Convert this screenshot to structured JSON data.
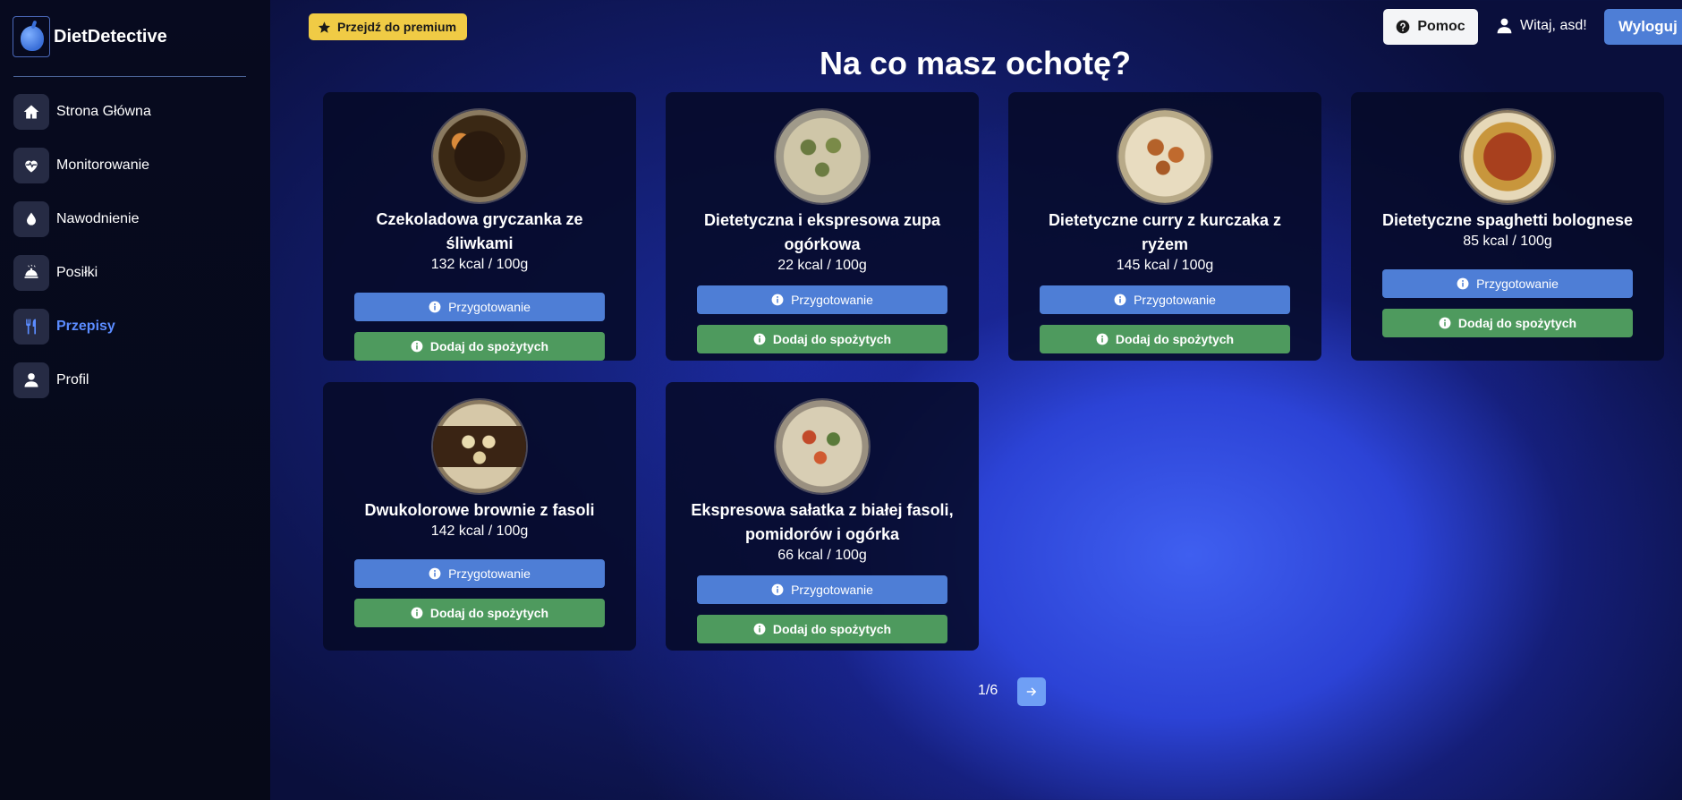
{
  "brand": {
    "name": "DietDetective"
  },
  "sidebar": {
    "items": [
      {
        "label": "Strona Główna",
        "icon": "home-icon"
      },
      {
        "label": "Monitorowanie",
        "icon": "heart-pulse-icon"
      },
      {
        "label": "Nawodnienie",
        "icon": "droplet-icon"
      },
      {
        "label": "Posiłki",
        "icon": "cloche-icon"
      },
      {
        "label": "Przepisy",
        "icon": "utensils-icon",
        "active": true
      },
      {
        "label": "Profil",
        "icon": "user-icon"
      }
    ]
  },
  "header": {
    "premium_label": "Przejdź do premium",
    "help_label": "Pomoc",
    "welcome_text": "Witaj, asd!",
    "logout_label": "Wyloguj"
  },
  "main": {
    "title": "Na co masz ochotę?",
    "recipes": [
      {
        "title": "Czekoladowa gryczanka ze śliwkami",
        "kcal": "132 kcal / 100g",
        "prep_label": "Przygotowanie",
        "add_label": "Dodaj do spożytych"
      },
      {
        "title": "Dietetyczna i ekspresowa zupa ogórkowa",
        "kcal": "22 kcal / 100g",
        "prep_label": "Przygotowanie",
        "add_label": "Dodaj do spożytych"
      },
      {
        "title": "Dietetyczne curry z kurczaka z ryżem",
        "kcal": "145 kcal / 100g",
        "prep_label": "Przygotowanie",
        "add_label": "Dodaj do spożytych"
      },
      {
        "title": "Dietetyczne spaghetti bolognese",
        "kcal": "85 kcal / 100g",
        "prep_label": "Przygotowanie",
        "add_label": "Dodaj do spożytych"
      },
      {
        "title": "Dwukolorowe brownie z fasoli",
        "kcal": "142 kcal / 100g",
        "prep_label": "Przygotowanie",
        "add_label": "Dodaj do spożytych"
      },
      {
        "title": "Ekspresowa sałatka z białej fasoli, pomidorów i ogórka",
        "kcal": "66 kcal / 100g",
        "prep_label": "Przygotowanie",
        "add_label": "Dodaj do spożytych"
      }
    ]
  },
  "pagination": {
    "text": "1/6"
  },
  "colors": {
    "accent": "#4e7ed6",
    "success": "#4e9a5e",
    "premium": "#f0cb45",
    "active_nav": "#5b8cff"
  }
}
